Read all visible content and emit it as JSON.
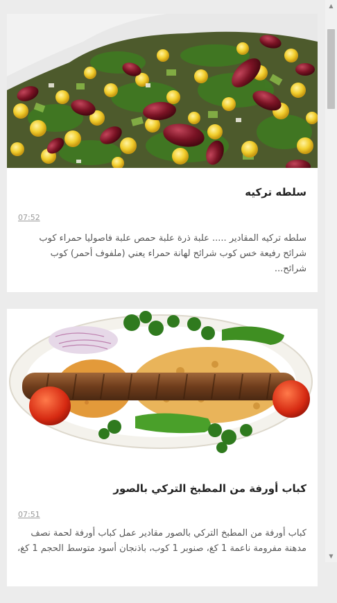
{
  "articles": [
    {
      "title": "سلطه تركيه",
      "time": "07:52",
      "excerpt": "سلطه تركيه المقادير ..... علبة ذرة علبة حمص علبة فاصوليا حمراء كوب شرائح رفيعة خس كوب شرائح لهانة حمراء يعني (ملفوف أحمر) كوب شرائح...",
      "image": "salad-photo"
    },
    {
      "title": "كباب أورفة من المطبخ التركي بالصور",
      "time": "07:51",
      "excerpt": "كباب أورفة من المطبخ التركي بالصور مقادير عمل كباب أورفة لحمة نصف مدهنة مفرومة ناعمة 1 كغ، صنوبر 1 كوب، باذنجان أسود متوسط الحجم 1 كغ،",
      "image": "kebab-photo"
    }
  ],
  "scrollbar": {
    "up_icon": "▲",
    "down_icon": "▼"
  }
}
